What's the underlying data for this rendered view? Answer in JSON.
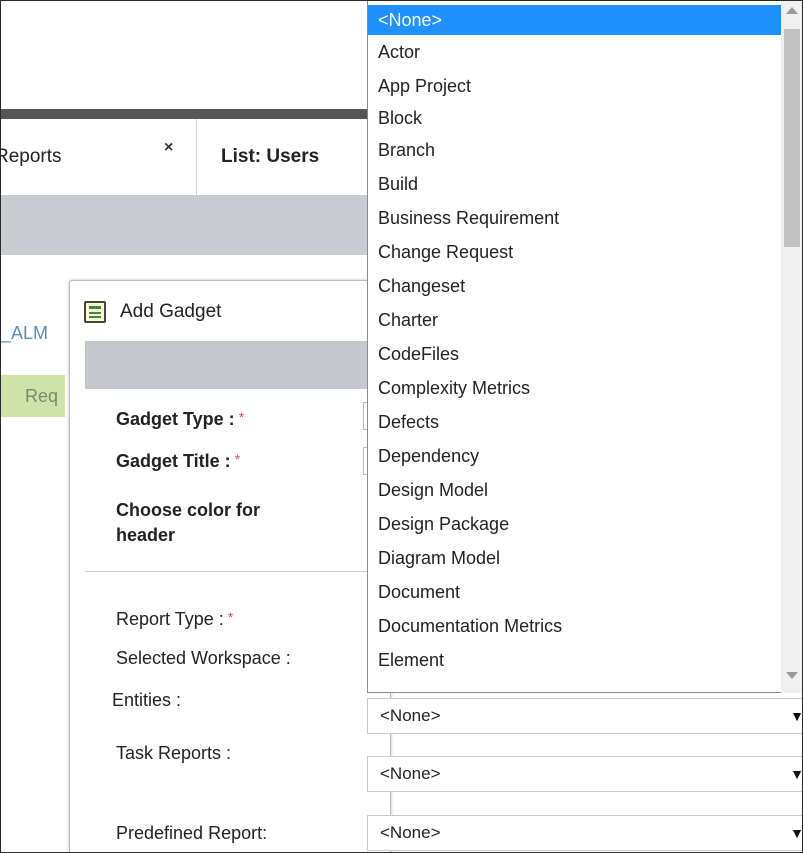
{
  "tabs": [
    {
      "label": "Reports",
      "close_glyph": "×"
    },
    {
      "label": "List: Users"
    }
  ],
  "background": {
    "link_text": "_ALM",
    "tag_text": "Req"
  },
  "dialog": {
    "title": "Add Gadget",
    "fields": {
      "gadget_type": "Gadget Type :",
      "gadget_title": "Gadget Title :",
      "choose_color_line1": "Choose color for",
      "choose_color_line2": "header",
      "report_type": "Report Type :",
      "selected_workspace": "Selected Workspace :",
      "entities": "Entities :",
      "task_reports": "Task Reports :",
      "predefined_report": "Predefined Report:"
    },
    "required_mark": "*"
  },
  "selects": {
    "entities": "<None>",
    "task_reports": "<None>",
    "predefined_report": "<None>",
    "arrow": "▼"
  },
  "dropdown": {
    "items": [
      "<None>",
      "Actor",
      "App Project",
      "Block",
      "Branch",
      "Build",
      "Business Requirement",
      "Change Request",
      "Changeset",
      "Charter",
      "CodeFiles",
      "Complexity Metrics",
      "Defects",
      "Dependency",
      "Design Model",
      "Design Package",
      "Diagram Model",
      "Document",
      "Documentation Metrics",
      "Element"
    ],
    "selected_index": 0,
    "selected_color": "#1e90ff"
  }
}
